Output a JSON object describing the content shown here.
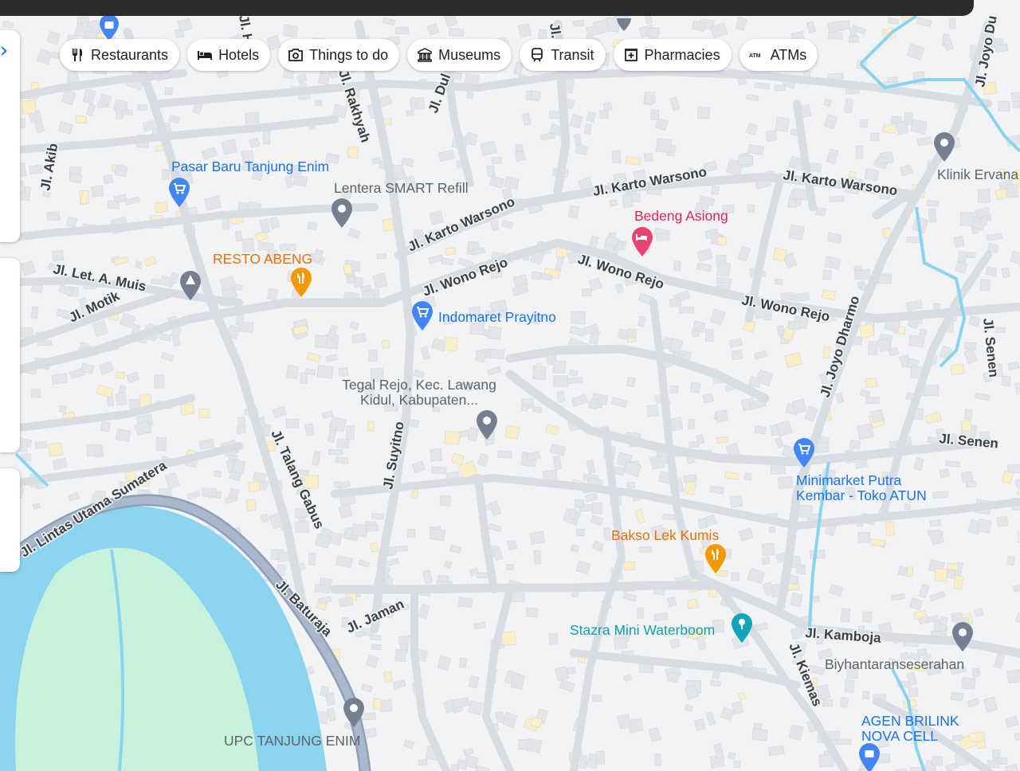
{
  "colors": {
    "background": "#f2f3f5",
    "road": "#d8dde3",
    "road_major": "#8ea0b8",
    "water": "#8ad4f0",
    "park": "#c9f2dc",
    "building": "#e3e5e8",
    "building_accent": "#fbefc8",
    "place_blue": "#1a73e8",
    "food_orange": "#e8710a",
    "lodging_pink": "#e3245f",
    "leisure_teal": "#129eaf",
    "generic_gray": "#5f6368"
  },
  "chips": [
    {
      "label": "Restaurants",
      "icon": "fork-knife-icon"
    },
    {
      "label": "Hotels",
      "icon": "bed-icon"
    },
    {
      "label": "Things to do",
      "icon": "camera-icon"
    },
    {
      "label": "Museums",
      "icon": "museum-icon"
    },
    {
      "label": "Transit",
      "icon": "train-icon"
    },
    {
      "label": "Pharmacies",
      "icon": "pharmacy-icon"
    },
    {
      "label": "ATMs",
      "icon": "atm-icon"
    }
  ],
  "places": {
    "pasar_baru": "Pasar Baru Tanjung Enim",
    "lentera": "Lentera SMART Refill",
    "resto_abeng": "RESTO ABENG",
    "bedeng_asiong": "Bedeng Asiong",
    "indomaret": "Indomaret Prayitno",
    "tegal_rejo_line1": "Tegal Rejo, Kec. Lawang",
    "tegal_rejo_line2": "Kidul, Kabupaten...",
    "minimarket_line1": "Minimarket Putra",
    "minimarket_line2": "Kembar - Toko ATUN",
    "bakso": "Bakso Lek Kumis",
    "stazra": "Stazra Mini Waterboom",
    "biyhantaran": "Biyhantaranseserahan",
    "agen_line1": "AGEN BRILINK",
    "agen_line2": "NOVA CELL",
    "upc": "UPC TANJUNG ENIM",
    "klinik": "Klinik Ervana"
  },
  "roads": {
    "akib": "Jl. Akib",
    "rakhyah": "Jl. Rakhyah",
    "dul": "Jl. Dul",
    "mu": "Jl. Mu",
    "joyo_top": "Jl. Joyo Du",
    "karto_1": "Jl. Karto Warsono",
    "karto_2": "Jl. Karto Warsono",
    "karto_3": "Jl. Karto Warsono",
    "wono_1": "Jl. Wono Rejo",
    "wono_2": "Jl. Wono Rejo",
    "wono_3": "Jl. Wono Rejo",
    "let_muis": "Jl. Let. A. Muis",
    "motik": "Jl. Motik",
    "joyo_dharmo": "Jl. Joyo Dharmo",
    "senen_v": "Jl. Senen",
    "senen_h": "Jl. Senen",
    "suyitno": "Jl. Suyitno",
    "talang_gabus": "Jl. Talang Gabus",
    "lintas": "Jl. Lintas Utama Sumatera",
    "baturaja": "Jl. Baturaja",
    "jaman": "Jl. Jaman",
    "kamboja": "Jl. Kamboja",
    "kiemas": "Jl. Kiemas",
    "hotel_partial": "Jl. Hotel"
  }
}
